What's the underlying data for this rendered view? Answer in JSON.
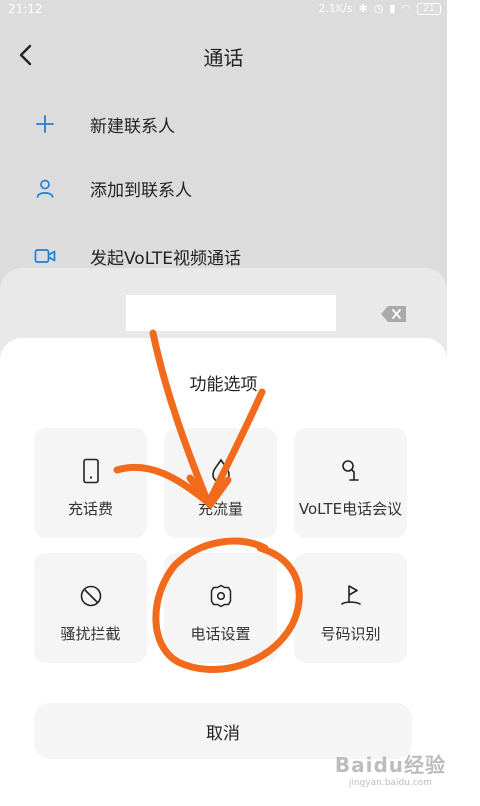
{
  "status_bar": {
    "time": "21:12",
    "network_speed": "2.1K/s",
    "battery": "21"
  },
  "header": {
    "title": "通话",
    "back_icon": "chevron-left-icon"
  },
  "menu": [
    {
      "label": "新建联系人",
      "icon": "plus-icon"
    },
    {
      "label": "添加到联系人",
      "icon": "person-icon"
    },
    {
      "label": "发起VoLTE视频通话",
      "icon": "video-camera-icon"
    }
  ],
  "sheet": {
    "title": "功能选项",
    "tiles": [
      {
        "label": "充话费",
        "icon": "phone-device-icon"
      },
      {
        "label": "充流量",
        "icon": "droplet-icon"
      },
      {
        "label": "VoLTE电话会议",
        "icon": "conference-icon"
      },
      {
        "label": "骚扰拦截",
        "icon": "block-icon"
      },
      {
        "label": "电话设置",
        "icon": "gear-icon"
      },
      {
        "label": "号码识别",
        "icon": "flag-icon"
      }
    ],
    "cancel_label": "取消"
  },
  "watermark": {
    "brand": "Baidu经验",
    "url": "jingyan.baidu.com"
  },
  "colors": {
    "accent_blue": "#1e7fd6",
    "annotation_orange": "#f26b1d",
    "tile_bg": "#f5f5f5"
  }
}
